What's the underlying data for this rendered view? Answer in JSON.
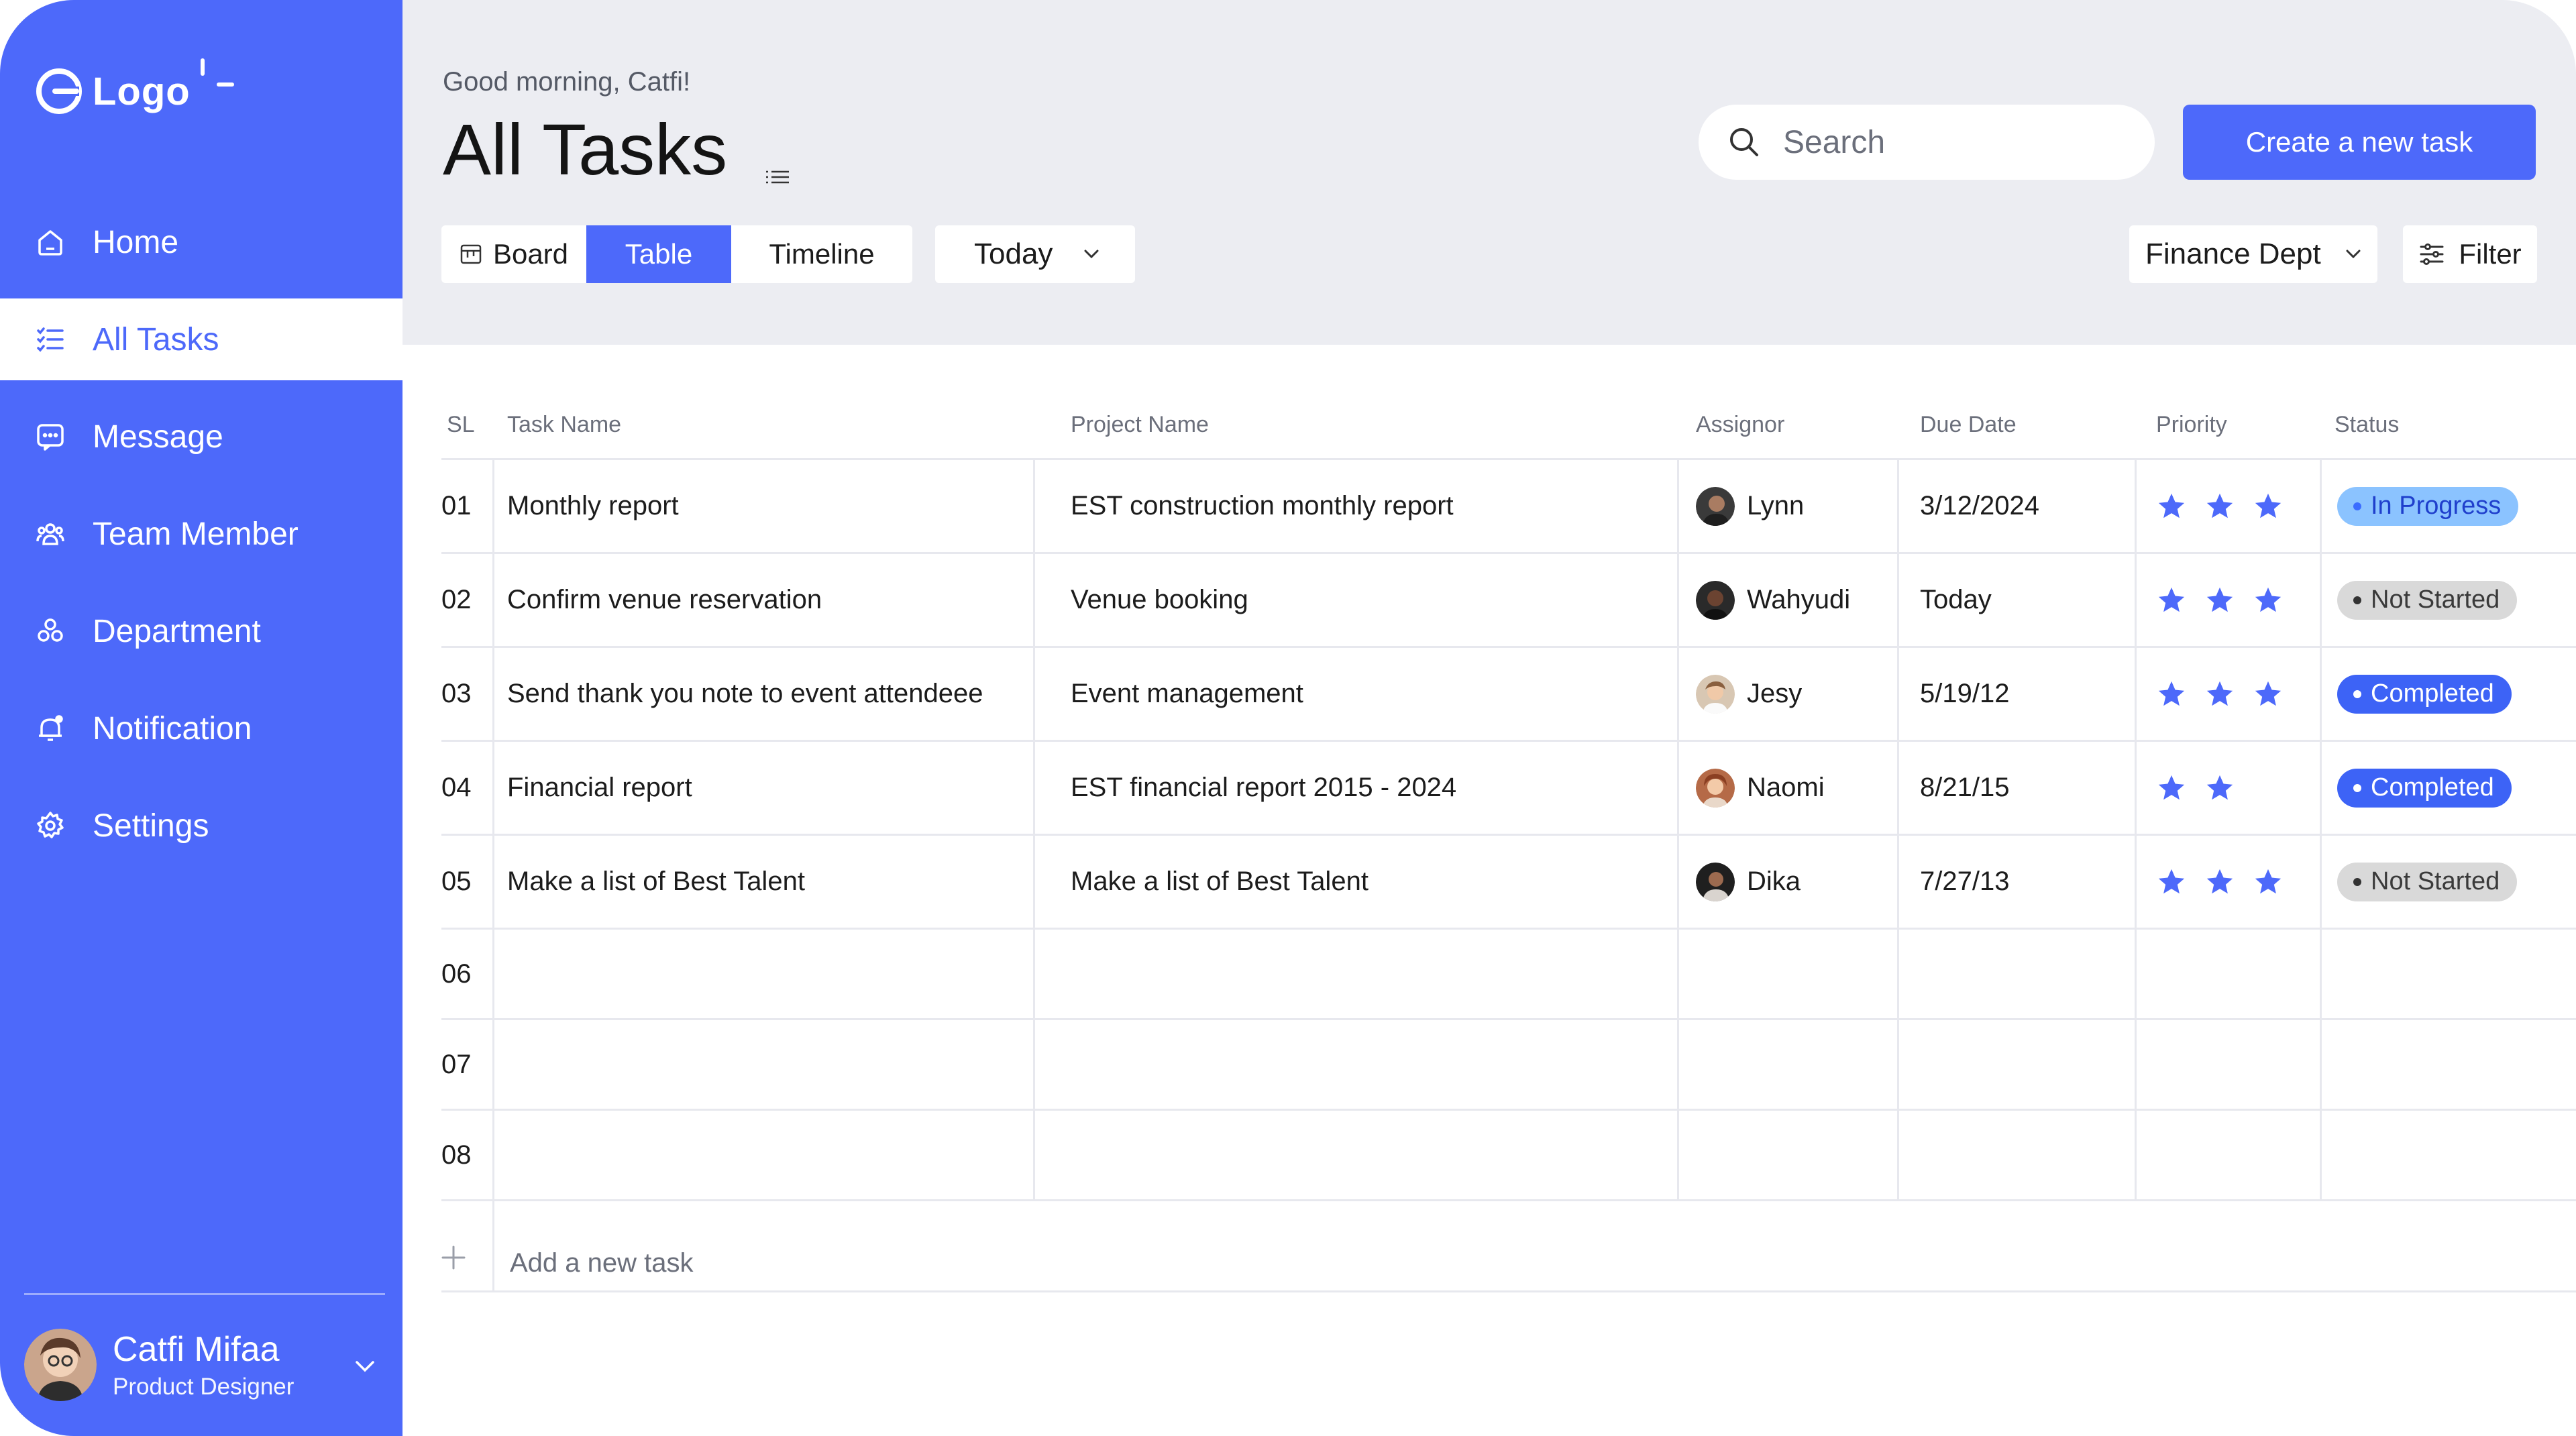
{
  "brand": {
    "logo_text": "Logo"
  },
  "sidebar": {
    "items": [
      {
        "label": "Home",
        "icon": "home-icon"
      },
      {
        "label": "All Tasks",
        "icon": "tasks-icon",
        "active": true
      },
      {
        "label": "Message",
        "icon": "message-icon"
      },
      {
        "label": "Team Member",
        "icon": "team-icon"
      },
      {
        "label": "Department",
        "icon": "department-icon"
      },
      {
        "label": "Notification",
        "icon": "bell-icon"
      },
      {
        "label": "Settings",
        "icon": "gear-icon"
      }
    ],
    "profile": {
      "name": "Catfi Mifaa",
      "role": "Product Designer"
    }
  },
  "header": {
    "greeting": "Good morning, Catfi!",
    "title": "All Tasks",
    "search_placeholder": "Search",
    "create_label": "Create a new task",
    "views": {
      "board": "Board",
      "table": "Table",
      "timeline": "Timeline",
      "active": "Table"
    },
    "date_filter": "Today",
    "department": "Finance Dept",
    "filter_label": "Filter"
  },
  "table": {
    "columns": {
      "sl": "SL",
      "task": "Task Name",
      "project": "Project Name",
      "assignor": "Assignor",
      "due": "Due Date",
      "priority": "Priority",
      "status": "Status"
    },
    "rows": [
      {
        "sl": "01",
        "task": "Monthly report",
        "project": "EST construction monthly report",
        "assignor": "Lynn",
        "due": "3/12/2024",
        "priority": 3,
        "status": "In Progress"
      },
      {
        "sl": "02",
        "task": "Confirm venue reservation",
        "project": "Venue booking",
        "assignor": "Wahyudi",
        "due": "Today",
        "priority": 3,
        "status": "Not Started"
      },
      {
        "sl": "03",
        "task": "Send thank you note to event attendeee",
        "project": "Event management",
        "assignor": "Jesy",
        "due": "5/19/12",
        "priority": 3,
        "status": "Completed"
      },
      {
        "sl": "04",
        "task": "Financial report",
        "project": "EST financial report 2015 - 2024",
        "assignor": "Naomi",
        "due": "8/21/15",
        "priority": 2,
        "status": "Completed"
      },
      {
        "sl": "05",
        "task": "Make a list of Best Talent",
        "project": "Make a list of Best Talent",
        "assignor": "Dika",
        "due": "7/27/13",
        "priority": 3,
        "status": "Not Started"
      }
    ],
    "empty_rows": [
      "06",
      "07",
      "08"
    ],
    "add_task_label": "Add a new task"
  },
  "colors": {
    "accent": "#4d69fa",
    "header_bg": "#ecedf2",
    "status_in_progress": "#8bc3ff",
    "status_completed": "#3d63f6",
    "status_not_started": "#d9d9d9"
  }
}
